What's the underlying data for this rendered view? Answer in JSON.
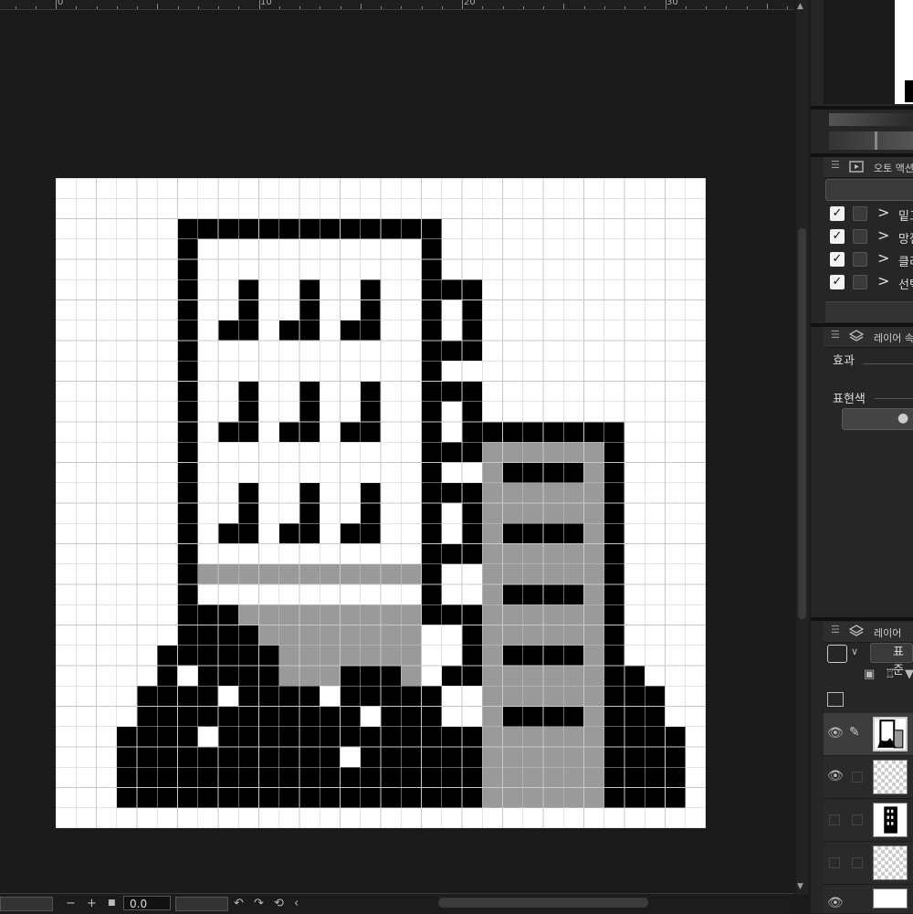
{
  "ruler": {
    "labels": [
      "0",
      "10",
      "20",
      "30"
    ]
  },
  "canvas": {
    "zoom_value": "0.0",
    "colors": {
      "black": "#000000",
      "white": "#ffffff",
      "gray": "#9a9a9a",
      "grid": "#c8c8c8",
      "background": "#1a1a1a"
    }
  },
  "bottom_bar": {
    "minus": "−",
    "plus": "+",
    "undo_icon": "undo-icon",
    "redo_icon": "redo-icon"
  },
  "panels": {
    "auto_action": {
      "title": "오토 액션",
      "items": [
        {
          "label": "밑그"
        },
        {
          "label": "망점"
        },
        {
          "label": "클리"
        },
        {
          "label": "선택"
        }
      ]
    },
    "layer_property": {
      "title": "레이어 속성",
      "effect": "효과",
      "expression_color": "표현색"
    },
    "layer": {
      "title": "레이어",
      "blend_mode": "표준"
    }
  }
}
